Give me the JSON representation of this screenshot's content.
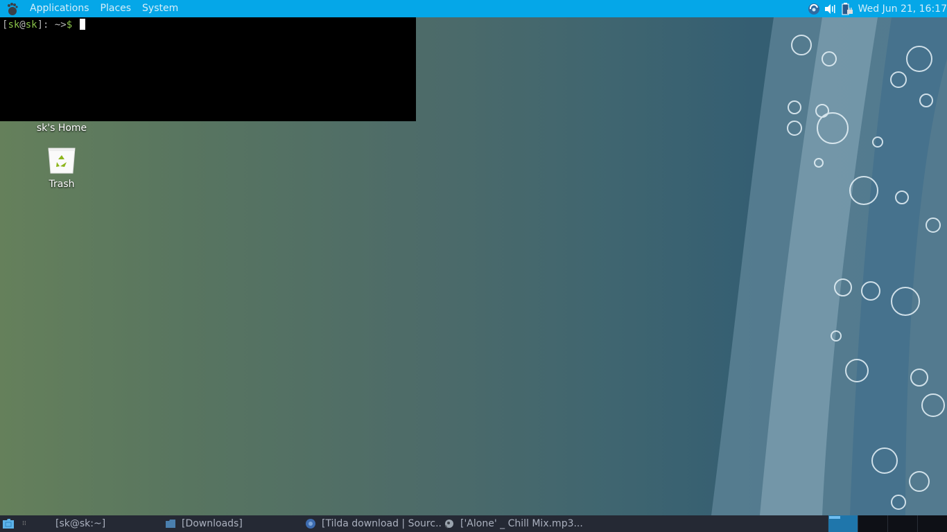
{
  "top_panel": {
    "logo_icon": "gnome-foot-icon",
    "menus": [
      "Applications",
      "Places",
      "System"
    ],
    "tray_icons": [
      "network-icon",
      "volume-icon",
      "battery-charging-icon"
    ],
    "clock": "Wed Jun 21, 16:17",
    "color": "#05a7e8"
  },
  "terminal": {
    "prompt_open": "[",
    "user": "sk",
    "at": "@",
    "host": "sk",
    "prompt_close": "]: ~>",
    "dollar": "$"
  },
  "desktop": {
    "icons": [
      {
        "label": "sk's Home",
        "icon": "home-folder-icon"
      },
      {
        "label": "Trash",
        "icon": "trash-icon"
      }
    ]
  },
  "bottom_panel": {
    "tasks": [
      {
        "label": "[sk@sk:~]",
        "icon": "terminal-icon"
      },
      {
        "label": "[Downloads]",
        "icon": "folder-icon"
      },
      {
        "label": "[Tilda download | Sourc...",
        "icon": "chromium-icon"
      },
      {
        "label": "['Alone' _ Chill Mix.mp3...",
        "icon": "audio-player-icon"
      }
    ],
    "workspaces": 4,
    "active_workspace": 1
  }
}
